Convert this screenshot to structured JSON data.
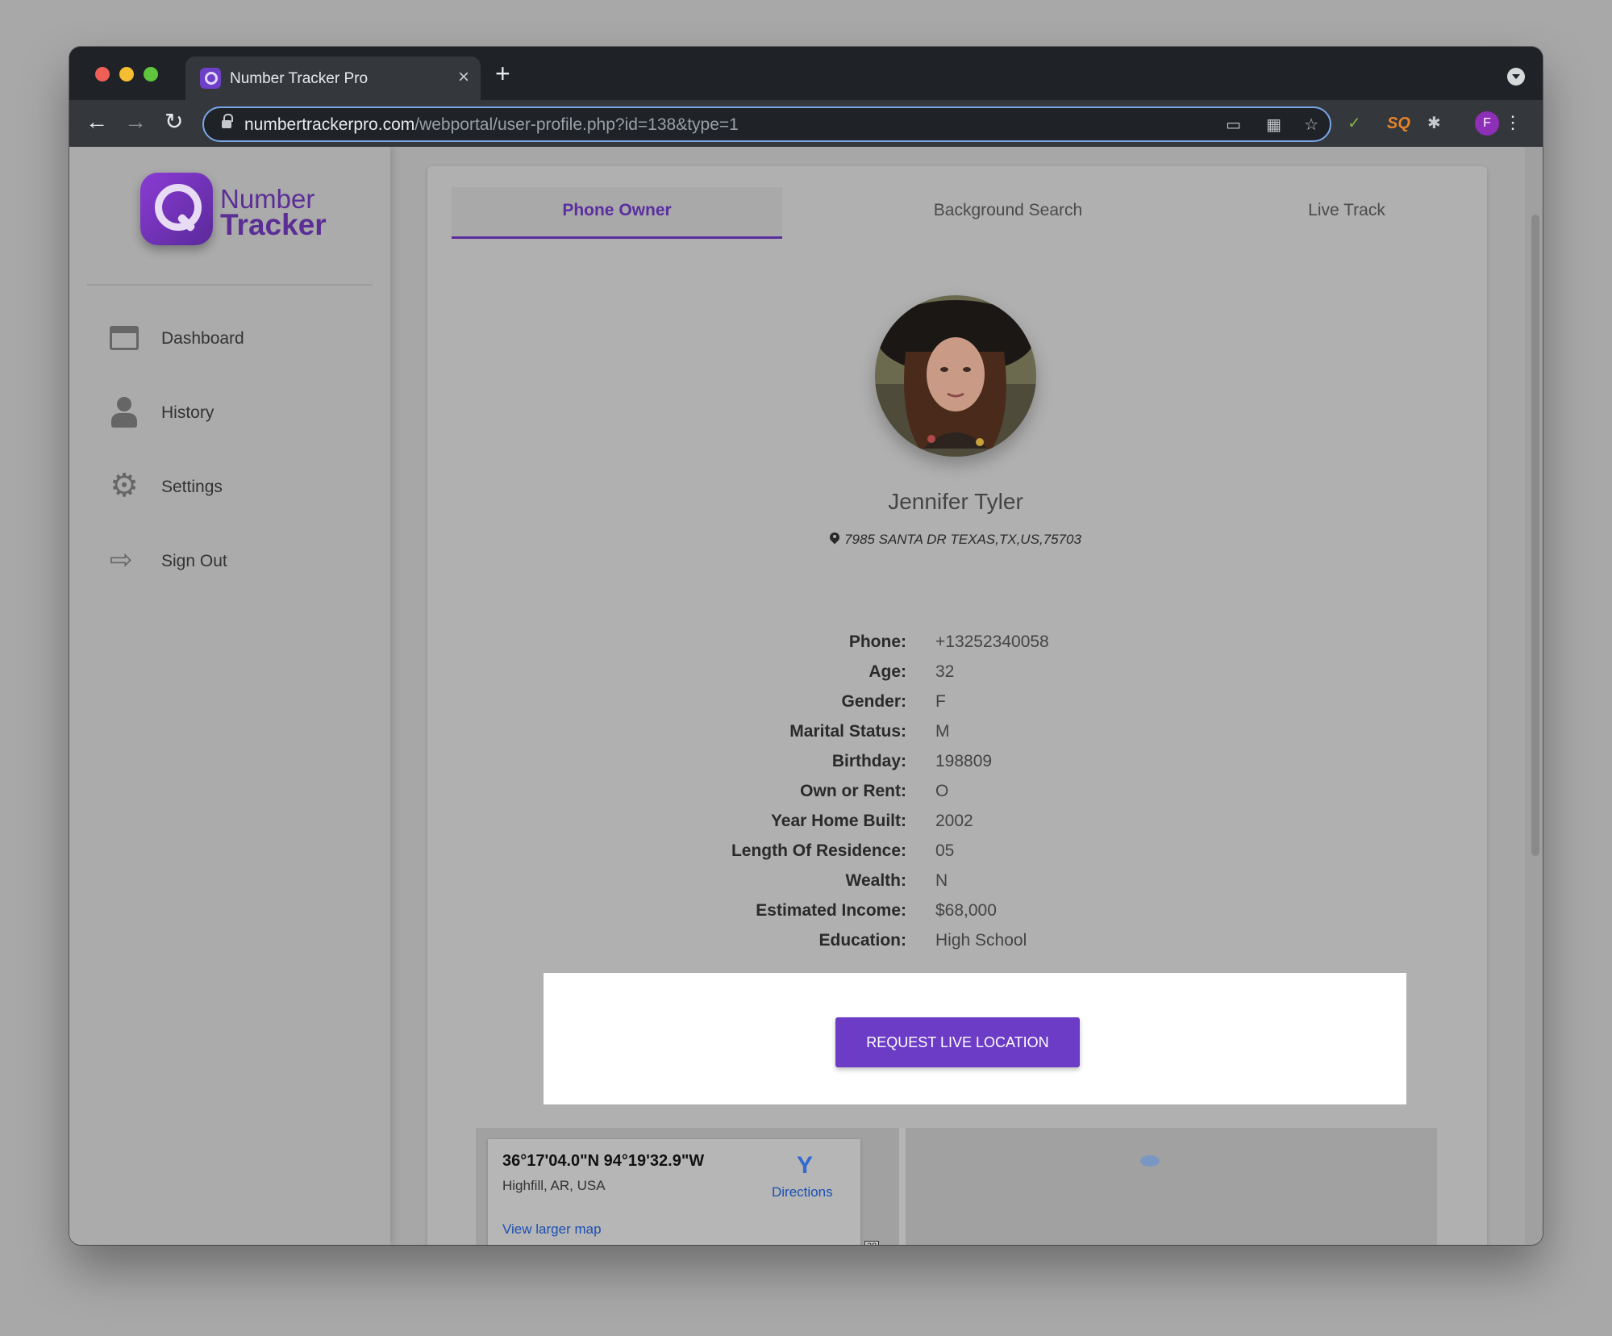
{
  "browser": {
    "tab_title": "Number Tracker Pro",
    "tab_close": "×",
    "new_tab": "+",
    "url_host": "numbertrackerpro.com",
    "url_path": "/webportal/user-profile.php?id=138&type=1",
    "profile_initial": "F",
    "back": "←",
    "forward": "→",
    "reload": "↻",
    "bookmark": "☆",
    "extensions": "✱",
    "menu": "⋮"
  },
  "sidebar": {
    "logo_line1": "Number",
    "logo_line2": "Tracker",
    "items": [
      {
        "label": "Dashboard",
        "icon": "window-icon"
      },
      {
        "label": "History",
        "icon": "user-icon"
      },
      {
        "label": "Settings",
        "icon": "gear-icon"
      },
      {
        "label": "Sign Out",
        "icon": "sign-out-icon"
      }
    ]
  },
  "tabs": [
    {
      "label": "Phone Owner",
      "active": true
    },
    {
      "label": "Background Search",
      "active": false
    },
    {
      "label": "Live Track",
      "active": false
    }
  ],
  "profile": {
    "name": "Jennifer Tyler",
    "address": "7985 SANTA DR TEXAS,TX,US,75703",
    "fields": [
      {
        "label": "Phone:",
        "value": "+13252340058"
      },
      {
        "label": "Age:",
        "value": "32"
      },
      {
        "label": "Gender:",
        "value": "F"
      },
      {
        "label": "Marital Status:",
        "value": "M"
      },
      {
        "label": "Birthday:",
        "value": "198809"
      },
      {
        "label": "Own or Rent:",
        "value": "O"
      },
      {
        "label": "Year Home Built:",
        "value": "2002"
      },
      {
        "label": "Length Of Residence:",
        "value": "05"
      },
      {
        "label": "Wealth:",
        "value": "N"
      },
      {
        "label": "Estimated Income:",
        "value": "$68,000"
      },
      {
        "label": "Education:",
        "value": "High School"
      }
    ]
  },
  "cta": {
    "label": "REQUEST LIVE LOCATION"
  },
  "map": {
    "coordinates": "36°17'04.0\"N 94°19'32.9\"W",
    "place": "Highfill, AR, USA",
    "directions": "Directions",
    "larger_map": "View larger map",
    "scale": "28"
  },
  "colors": {
    "accent": "#6c3cc6",
    "brand": "#5b2e96",
    "link": "#1a4fb3"
  }
}
